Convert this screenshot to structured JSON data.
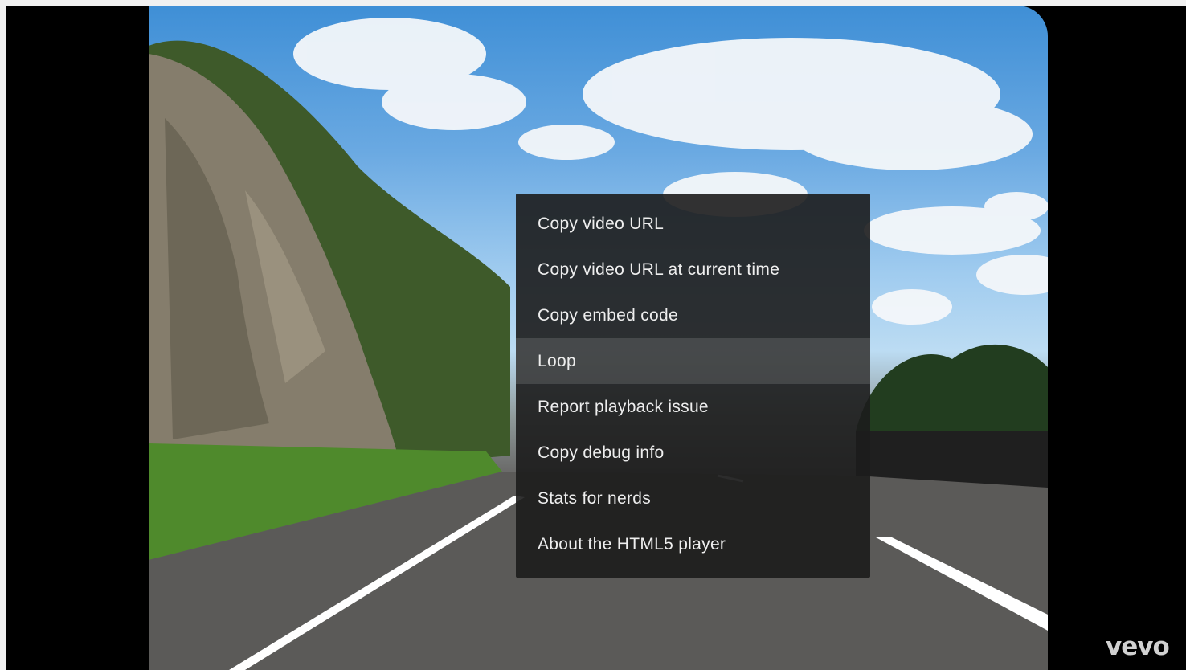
{
  "context_menu": {
    "items": [
      {
        "label": "Copy video URL"
      },
      {
        "label": "Copy video URL at current time"
      },
      {
        "label": "Copy embed code"
      },
      {
        "label": "Loop"
      },
      {
        "label": "Report playback issue"
      },
      {
        "label": "Copy debug info"
      },
      {
        "label": "Stats for nerds"
      },
      {
        "label": "About the HTML5 player"
      }
    ],
    "highlighted_item": "Loop"
  },
  "watermark": {
    "text": "vevo"
  },
  "colors": {
    "menu_background": "#1c1c1c",
    "menu_text": "#eeeeee",
    "player_background": "#000000",
    "page_background": "#f1f1f1"
  }
}
